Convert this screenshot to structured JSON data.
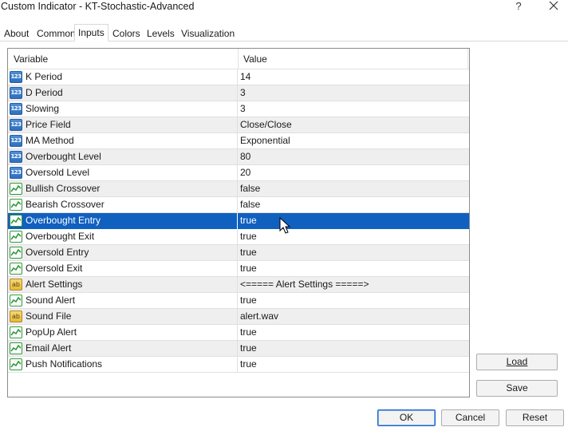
{
  "window": {
    "title": "Custom Indicator - KT-Stochastic-Advanced",
    "help_glyph": "?",
    "close_icon": "close-icon"
  },
  "tabs": [
    {
      "label": "About"
    },
    {
      "label": "Common"
    },
    {
      "label": "Inputs"
    },
    {
      "label": "Colors"
    },
    {
      "label": "Levels"
    },
    {
      "label": "Visualization"
    }
  ],
  "active_tab": "Inputs",
  "table": {
    "headers": {
      "variable": "Variable",
      "value": "Value"
    },
    "rows": [
      {
        "icon": "number-icon",
        "variable": "K Period",
        "value": "14"
      },
      {
        "icon": "number-icon",
        "variable": "D Period",
        "value": "3"
      },
      {
        "icon": "number-icon",
        "variable": "Slowing",
        "value": "3"
      },
      {
        "icon": "number-icon",
        "variable": "Price Field",
        "value": "Close/Close"
      },
      {
        "icon": "number-icon",
        "variable": "MA Method",
        "value": "Exponential"
      },
      {
        "icon": "number-icon",
        "variable": "Overbought Level",
        "value": "80"
      },
      {
        "icon": "number-icon",
        "variable": "Oversold Level",
        "value": "20"
      },
      {
        "icon": "boolean-icon",
        "variable": "Bullish Crossover",
        "value": "false"
      },
      {
        "icon": "boolean-icon",
        "variable": "Bearish Crossover",
        "value": "false"
      },
      {
        "icon": "boolean-icon",
        "variable": "Overbought Entry",
        "value": "true",
        "selected": true
      },
      {
        "icon": "boolean-icon",
        "variable": "Overbought Exit",
        "value": "true"
      },
      {
        "icon": "boolean-icon",
        "variable": "Oversold Entry",
        "value": "true"
      },
      {
        "icon": "boolean-icon",
        "variable": "Oversold Exit",
        "value": "true"
      },
      {
        "icon": "string-icon",
        "variable": "Alert Settings",
        "value": "<===== Alert Settings =====>"
      },
      {
        "icon": "boolean-icon",
        "variable": "Sound Alert",
        "value": "true"
      },
      {
        "icon": "string-icon",
        "variable": "Sound File",
        "value": "alert.wav"
      },
      {
        "icon": "boolean-icon",
        "variable": "PopUp Alert",
        "value": "true"
      },
      {
        "icon": "boolean-icon",
        "variable": "Email Alert",
        "value": "true"
      },
      {
        "icon": "boolean-icon",
        "variable": "Push Notifications",
        "value": "true"
      }
    ]
  },
  "icon_text": {
    "number": "123",
    "string": "ab"
  },
  "buttons": {
    "load": "Load",
    "save": "Save",
    "ok": "OK",
    "cancel": "Cancel",
    "reset": "Reset"
  },
  "colors": {
    "selection": "#1060c0",
    "alt_row": "#efefef",
    "number_icon": "#2e6fc0",
    "boolean_icon": "#2f9a3a",
    "string_icon": "#e6b83c"
  }
}
